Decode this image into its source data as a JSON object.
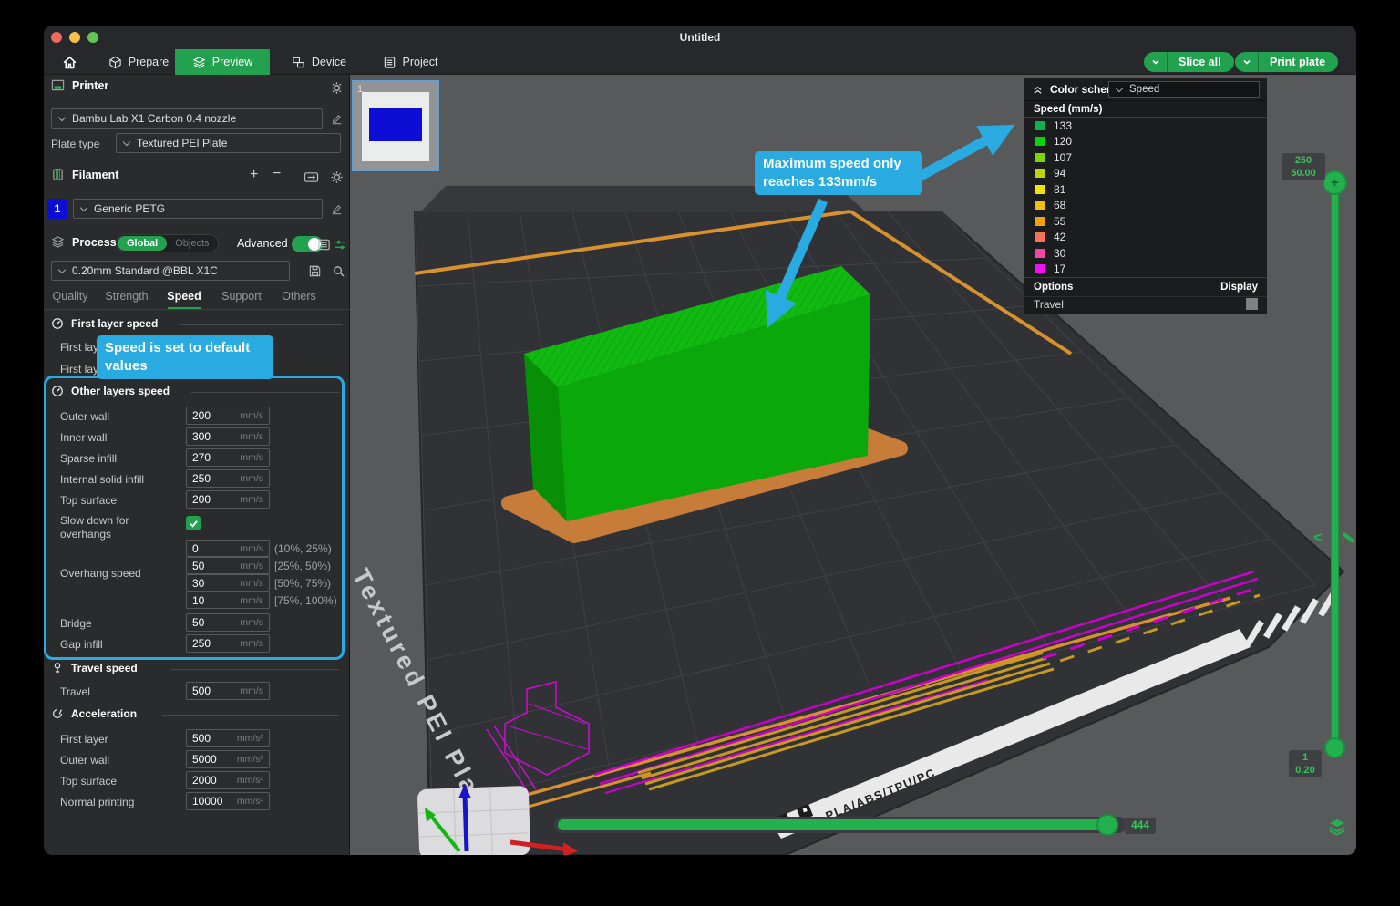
{
  "window": {
    "title": "Untitled"
  },
  "nav": {
    "tabs": [
      "Prepare",
      "Preview",
      "Device",
      "Project"
    ],
    "slice_all": "Slice all",
    "print_plate": "Print plate"
  },
  "sidebar": {
    "printer": {
      "title": "Printer",
      "preset": "Bambu Lab X1 Carbon 0.4 nozzle",
      "plate_type_label": "Plate type",
      "plate_type": "Textured PEI Plate"
    },
    "filament": {
      "title": "Filament",
      "slot": "1",
      "preset": "Generic PETG"
    },
    "process": {
      "title": "Process",
      "global": "Global",
      "objects": "Objects",
      "advanced": "Advanced",
      "preset": "0.20mm Standard @BBL X1C"
    },
    "tabs": [
      "Quality",
      "Strength",
      "Speed",
      "Support",
      "Others"
    ],
    "first_layer": {
      "title": "First layer speed",
      "row1": "First lay",
      "row2": "First lay"
    },
    "other": {
      "title": "Other layers speed",
      "rows": [
        {
          "label": "Outer wall",
          "value": "200",
          "unit": "mm/s"
        },
        {
          "label": "Inner wall",
          "value": "300",
          "unit": "mm/s"
        },
        {
          "label": "Sparse infill",
          "value": "270",
          "unit": "mm/s"
        },
        {
          "label": "Internal solid infill",
          "value": "250",
          "unit": "mm/s"
        },
        {
          "label": "Top surface",
          "value": "200",
          "unit": "mm/s"
        }
      ],
      "slow_down": "Slow down for overhangs",
      "overhang_label": "Overhang speed",
      "overhang": [
        {
          "value": "0",
          "unit": "mm/s",
          "range": "(10%, 25%)"
        },
        {
          "value": "50",
          "unit": "mm/s",
          "range": "[25%, 50%)"
        },
        {
          "value": "30",
          "unit": "mm/s",
          "range": "[50%, 75%)"
        },
        {
          "value": "10",
          "unit": "mm/s",
          "range": "[75%, 100%)"
        }
      ],
      "bridge": {
        "label": "Bridge",
        "value": "50",
        "unit": "mm/s"
      },
      "gap": {
        "label": "Gap infill",
        "value": "250",
        "unit": "mm/s"
      }
    },
    "travel": {
      "title": "Travel speed",
      "label": "Travel",
      "value": "500",
      "unit": "mm/s"
    },
    "accel": {
      "title": "Acceleration",
      "rows": [
        {
          "label": "First layer",
          "value": "500",
          "unit": "mm/s²"
        },
        {
          "label": "Outer wall",
          "value": "5000",
          "unit": "mm/s²"
        },
        {
          "label": "Top surface",
          "value": "2000",
          "unit": "mm/s²"
        },
        {
          "label": "Normal printing",
          "value": "10000",
          "unit": "mm/s²"
        }
      ]
    }
  },
  "callouts": {
    "default_speed": "Speed is set to default values",
    "max_speed": "Maximum speed only reaches 133mm/s"
  },
  "legend": {
    "title": "Color scheme",
    "scheme": "Speed",
    "subtitle": "Speed (mm/s)",
    "items": [
      {
        "value": "133",
        "color": "#0eb14d"
      },
      {
        "value": "120",
        "color": "#0bd30b"
      },
      {
        "value": "107",
        "color": "#7fd30c"
      },
      {
        "value": "94",
        "color": "#bfd30c"
      },
      {
        "value": "81",
        "color": "#f2e20c"
      },
      {
        "value": "68",
        "color": "#f2c00c"
      },
      {
        "value": "55",
        "color": "#f2a10c"
      },
      {
        "value": "42",
        "color": "#f17457"
      },
      {
        "value": "30",
        "color": "#f146a1"
      },
      {
        "value": "17",
        "color": "#ef12ef"
      }
    ],
    "options": "Options",
    "display": "Display",
    "travel": "Travel"
  },
  "viewport": {
    "thumb_number": "1",
    "plate_name": "Textured PEI Plate",
    "plate_materials": "PLA/ABS/TPU/PC"
  },
  "sliders": {
    "v_top1": "250",
    "v_top2": "50.00",
    "v_bot1": "1",
    "v_bot2": "0.20",
    "h_value": "444"
  },
  "colors": {
    "accent": "#22a14e",
    "highlight": "#29abe2",
    "model": "#0aa80a",
    "brim": "#c87c3a"
  }
}
